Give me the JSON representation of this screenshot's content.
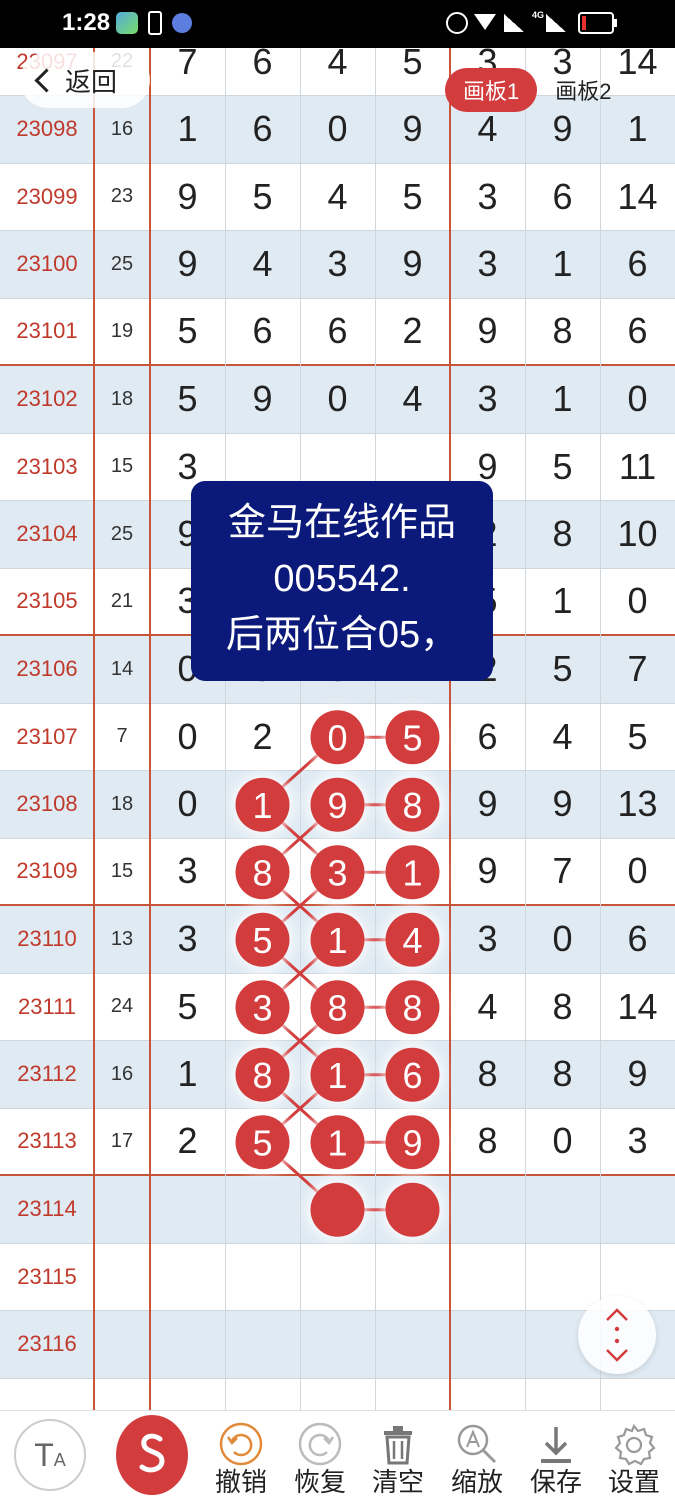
{
  "status_bar": {
    "time": "1:28",
    "network": "4G"
  },
  "header": {
    "back_label": "返回",
    "boards": [
      "画板1",
      "画板2"
    ],
    "active_board": 0
  },
  "note": {
    "lines": [
      "金马在线作品",
      "005542.",
      "后两位合05，"
    ]
  },
  "table": {
    "rows": [
      {
        "issue": "23097",
        "sum": "22",
        "digits": [
          "7",
          "6",
          "4",
          "5",
          "3",
          "3",
          "14"
        ]
      },
      {
        "issue": "23098",
        "sum": "16",
        "digits": [
          "1",
          "6",
          "0",
          "9",
          "4",
          "9",
          "1"
        ]
      },
      {
        "issue": "23099",
        "sum": "23",
        "digits": [
          "9",
          "5",
          "4",
          "5",
          "3",
          "6",
          "14"
        ]
      },
      {
        "issue": "23100",
        "sum": "25",
        "digits": [
          "9",
          "4",
          "3",
          "9",
          "3",
          "1",
          "6"
        ]
      },
      {
        "issue": "23101",
        "sum": "19",
        "digits": [
          "5",
          "6",
          "6",
          "2",
          "9",
          "8",
          "6"
        ]
      },
      {
        "issue": "23102",
        "sum": "18",
        "digits": [
          "5",
          "9",
          "0",
          "4",
          "3",
          "1",
          "0"
        ]
      },
      {
        "issue": "23103",
        "sum": "15",
        "digits": [
          "3",
          "",
          "",
          "",
          "9",
          "5",
          "11"
        ]
      },
      {
        "issue": "23104",
        "sum": "25",
        "digits": [
          "9",
          "",
          "",
          "",
          "2",
          "8",
          "10"
        ]
      },
      {
        "issue": "23105",
        "sum": "21",
        "digits": [
          "3",
          "",
          "",
          "",
          "5",
          "1",
          "0"
        ]
      },
      {
        "issue": "23106",
        "sum": "14",
        "digits": [
          "0",
          "5",
          "8",
          "1",
          "2",
          "5",
          "7"
        ]
      },
      {
        "issue": "23107",
        "sum": "7",
        "digits": [
          "0",
          "2",
          "0",
          "5",
          "6",
          "4",
          "5"
        ]
      },
      {
        "issue": "23108",
        "sum": "18",
        "digits": [
          "0",
          "1",
          "9",
          "8",
          "9",
          "9",
          "13"
        ]
      },
      {
        "issue": "23109",
        "sum": "15",
        "digits": [
          "3",
          "8",
          "3",
          "1",
          "9",
          "7",
          "0"
        ]
      },
      {
        "issue": "23110",
        "sum": "13",
        "digits": [
          "3",
          "5",
          "1",
          "4",
          "3",
          "0",
          "6"
        ]
      },
      {
        "issue": "23111",
        "sum": "24",
        "digits": [
          "5",
          "3",
          "8",
          "8",
          "4",
          "8",
          "14"
        ]
      },
      {
        "issue": "23112",
        "sum": "16",
        "digits": [
          "1",
          "8",
          "1",
          "6",
          "8",
          "8",
          "9"
        ]
      },
      {
        "issue": "23113",
        "sum": "17",
        "digits": [
          "2",
          "5",
          "1",
          "9",
          "8",
          "0",
          "3"
        ]
      },
      {
        "issue": "23114",
        "sum": "",
        "digits": [
          "",
          "",
          "",
          "",
          "",
          "",
          ""
        ]
      },
      {
        "issue": "23115",
        "sum": "",
        "digits": [
          "",
          "",
          "",
          "",
          "",
          "",
          ""
        ]
      },
      {
        "issue": "23116",
        "sum": "",
        "digits": [
          "",
          "",
          "",
          "",
          "",
          "",
          ""
        ]
      }
    ],
    "marked": [
      {
        "row": 10,
        "col": 2,
        "value": "0"
      },
      {
        "row": 10,
        "col": 3,
        "value": "5"
      },
      {
        "row": 11,
        "col": 1,
        "value": "1"
      },
      {
        "row": 11,
        "col": 2,
        "value": "9"
      },
      {
        "row": 11,
        "col": 3,
        "value": "8"
      },
      {
        "row": 12,
        "col": 1,
        "value": "8"
      },
      {
        "row": 12,
        "col": 2,
        "value": "3"
      },
      {
        "row": 12,
        "col": 3,
        "value": "1"
      },
      {
        "row": 13,
        "col": 1,
        "value": "5"
      },
      {
        "row": 13,
        "col": 2,
        "value": "1"
      },
      {
        "row": 13,
        "col": 3,
        "value": "4"
      },
      {
        "row": 14,
        "col": 1,
        "value": "3"
      },
      {
        "row": 14,
        "col": 2,
        "value": "8"
      },
      {
        "row": 14,
        "col": 3,
        "value": "8"
      },
      {
        "row": 15,
        "col": 1,
        "value": "8"
      },
      {
        "row": 15,
        "col": 2,
        "value": "1"
      },
      {
        "row": 15,
        "col": 3,
        "value": "6"
      },
      {
        "row": 16,
        "col": 1,
        "value": "5"
      },
      {
        "row": 16,
        "col": 2,
        "value": "1"
      },
      {
        "row": 16,
        "col": 3,
        "value": "9"
      },
      {
        "row": 17,
        "col": 2,
        "value": ""
      },
      {
        "row": 17,
        "col": 3,
        "value": ""
      }
    ],
    "links": [
      [
        [
          10,
          2
        ],
        [
          10,
          3
        ]
      ],
      [
        [
          10,
          2
        ],
        [
          11,
          1
        ]
      ],
      [
        [
          11,
          1
        ],
        [
          12,
          2
        ]
      ],
      [
        [
          11,
          2
        ],
        [
          11,
          3
        ]
      ],
      [
        [
          11,
          2
        ],
        [
          12,
          1
        ]
      ],
      [
        [
          12,
          1
        ],
        [
          13,
          2
        ]
      ],
      [
        [
          12,
          2
        ],
        [
          12,
          3
        ]
      ],
      [
        [
          12,
          2
        ],
        [
          13,
          1
        ]
      ],
      [
        [
          13,
          1
        ],
        [
          14,
          2
        ]
      ],
      [
        [
          13,
          2
        ],
        [
          13,
          3
        ]
      ],
      [
        [
          13,
          2
        ],
        [
          14,
          1
        ]
      ],
      [
        [
          14,
          1
        ],
        [
          15,
          2
        ]
      ],
      [
        [
          14,
          2
        ],
        [
          14,
          3
        ]
      ],
      [
        [
          14,
          2
        ],
        [
          15,
          1
        ]
      ],
      [
        [
          15,
          1
        ],
        [
          16,
          2
        ]
      ],
      [
        [
          15,
          2
        ],
        [
          15,
          3
        ]
      ],
      [
        [
          15,
          2
        ],
        [
          16,
          1
        ]
      ],
      [
        [
          16,
          1
        ],
        [
          17,
          2
        ]
      ],
      [
        [
          16,
          2
        ],
        [
          16,
          3
        ]
      ],
      [
        [
          17,
          2
        ],
        [
          17,
          3
        ]
      ]
    ]
  },
  "colors": {
    "accent": "#d23c3c",
    "note_bg": "#0b1a7a",
    "issue_text": "#c0392b",
    "row_alt": "#dfeaf3",
    "divider": "#c8553a"
  },
  "toolbar": {
    "items": [
      {
        "label": "撤销",
        "icon": "undo-icon"
      },
      {
        "label": "恢复",
        "icon": "redo-icon"
      },
      {
        "label": "清空",
        "icon": "trash-icon"
      },
      {
        "label": "缩放",
        "icon": "zoom-icon"
      },
      {
        "label": "保存",
        "icon": "download-icon"
      },
      {
        "label": "设置",
        "icon": "gear-icon"
      }
    ],
    "text_size_icon": "text-size-icon",
    "pen_icon": "pen-icon"
  }
}
